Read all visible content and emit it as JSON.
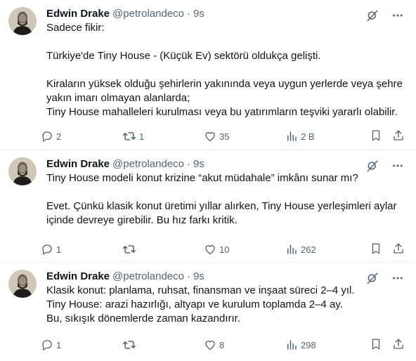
{
  "tweets": [
    {
      "author": "Edwin Drake",
      "handle": "@petrolandeco",
      "sep": "·",
      "time": "9s",
      "lines": [
        "Sadece fikir:",
        "",
        "Türkiye'de Tiny House - (Küçük Ev) sektörü oldukça gelişti.",
        "",
        "Kiraların yüksek olduğu şehirlerin yakınında veya uygun yerlerde veya şehre",
        "yakın imarı olmayan alanlarda;",
        "Tiny House mahalleleri kurulması veya bu yatırımların teşviki yararlı olabilir."
      ],
      "replies": "2",
      "retweets": "1",
      "likes": "35",
      "views": "2 B"
    },
    {
      "author": "Edwin Drake",
      "handle": "@petrolandeco",
      "sep": "·",
      "time": "9s",
      "lines": [
        "Tiny House modeli konut krizine “akut müdahale” imkânı sunar mı?",
        "",
        "Evet. Çünkü klasik konut üretimi yıllar alırken, Tiny House yerleşimleri aylar",
        "içinde devreye girebilir. Bu hız farkı kritik."
      ],
      "replies": "1",
      "retweets": "",
      "likes": "10",
      "views": "262"
    },
    {
      "author": "Edwin Drake",
      "handle": "@petrolandeco",
      "sep": "·",
      "time": "9s",
      "lines": [
        "Klasik konut: planlama, ruhsat, finansman ve inşaat süreci 2–4 yıl.",
        "Tiny House: arazi hazırlığı, altyapı ve kurulum toplamda 2–4 ay.",
        "Bu, sıkışık dönemlerde zaman kazandırır."
      ],
      "replies": "1",
      "retweets": "",
      "likes": "8",
      "views": "298"
    }
  ],
  "icons": {
    "grok": "grok-icon",
    "more": "more-icon",
    "reply": "reply-icon",
    "retweet": "retweet-icon",
    "like": "like-icon",
    "views": "views-icon",
    "bookmark": "bookmark-icon",
    "share": "share-icon"
  },
  "colors": {
    "text": "#0f1419",
    "secondary": "#536471",
    "divider": "#eff3f4"
  }
}
